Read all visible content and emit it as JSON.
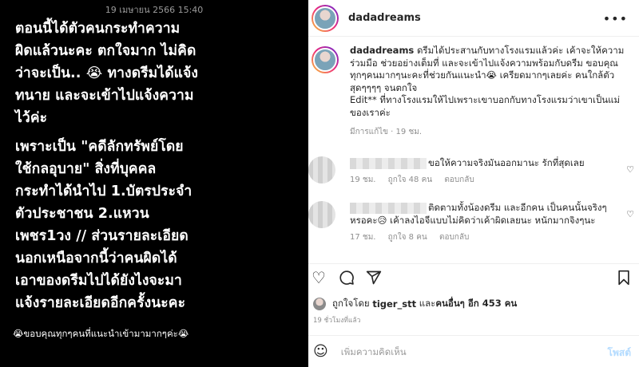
{
  "story": {
    "timestamp": "19 เมษายน 2566 15:40",
    "lines_block1": [
      "ตอนนี้ได้ตัวคนกระทำความ",
      "ผิดแล้วนะคะ ตกใจมาก ไม่คิด",
      "ว่าจะเป็น.. 😭 ทางดรีมได้แจ้ง",
      "ทนาย และจะเข้าไปแจ้งความ",
      "ไว้ค่ะ"
    ],
    "lines_block2": [
      "เพราะเป็น \"คดีลักทรัพย์โดย",
      "ใช้กลอุบาย\" สิ่งที่บุคคล",
      "กระทำได้นำไป 1.บัตรประจำ",
      "ตัวประชาชน 2.แหวน",
      "เพชร1วง // ส่วนรายละเอียด",
      "นอกเหนือจากนี้ว่าคนผิดได้",
      "เอาของดรีมไปได้ยังไงจะมา",
      "แจ้งรายละเอียดอีกครั้งนะคะ"
    ],
    "footer": "😭ขอบคุณทุกๆคนที่แนะนำเข้ามามากๆค่ะ😭"
  },
  "post": {
    "username": "dadadreams",
    "more_icon": "more-horizontal-icon",
    "caption": {
      "username": "dadadreams",
      "text": "ดรีมได้ประสานกับทางโรงแรมแล้วค่ะ เค้าจะให้ความร่วมมือ ช่วยอย่างเต็มที่ และจะเข้าไปแจ้งความพร้อมกับดรีม ขอบคุณทุกๆคนมากๆนะคะที่ช่วยกันแนะนำ😭 เครียดมากๆเลยค่ะ คนใกล้ตัวสุดๆๆๆๆ จนตกใจ",
      "edit": "Edit** ที่ทางโรงแรมให้ไปเพราะเขาบอกกับทางโรงแรมว่าเขาเป็นแม่ของเราค่ะ",
      "meta": "มีการแก้ไข · 19 ชม."
    },
    "comments": [
      {
        "text": "ขอให้ความจริงมันออกมานะ รักที่สุดเลย",
        "time": "19 ชม.",
        "likes": "ถูกใจ 48 คน",
        "reply": "ตอบกลับ"
      },
      {
        "text": "ติดตามทั้งน้องดรีม และอีกคน เป็นคนนั้นจริงๆ หรอคะ😥 เค้าลงไอจีแบบไม่คิดว่าเค้าผิดเลยนะ หนักมากจิงๆนะ",
        "time": "17 ชม.",
        "likes": "ถูกใจ 8 คน",
        "reply": "ตอบกลับ"
      }
    ],
    "actions": {
      "like": "heart-icon",
      "comment": "comment-icon",
      "share": "share-icon",
      "save": "bookmark-icon"
    },
    "likes_line": {
      "prefix": "ถูกใจโดย",
      "user": "tiger_stt",
      "connector": "และ",
      "others": "คนอื่นๆ อีก 453 คน"
    },
    "date": "19 ชั่วโมงที่แล้ว",
    "comment_input_placeholder": "เพิ่มความคิดเห็น",
    "post_button": "โพสต์"
  }
}
